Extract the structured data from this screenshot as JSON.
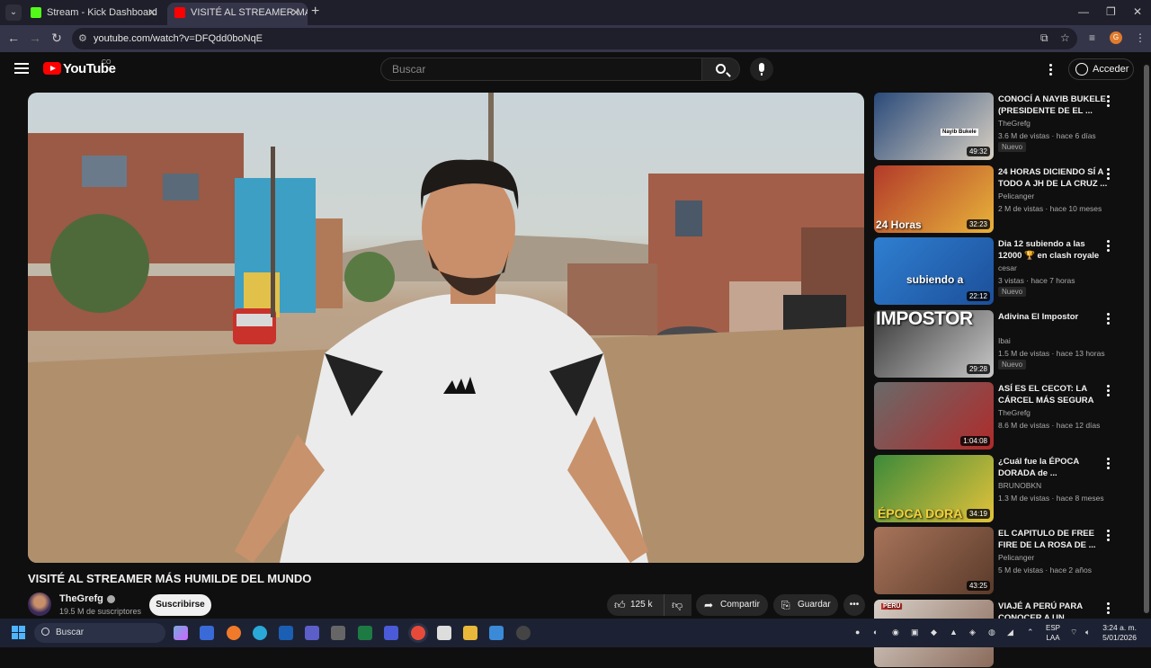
{
  "browser": {
    "tabs": [
      {
        "title": "Stream - Kick Dashboard",
        "favicon_color": "#53fc18",
        "active": false
      },
      {
        "title": "VISITÉ AL STREAMER MÁS H",
        "favicon_color": "#ff0000",
        "active": true
      }
    ],
    "url": "youtube.com/watch?v=DFQdd0boNqE",
    "profile_initial": "G"
  },
  "youtube": {
    "logo_text": "YouTube",
    "region": "CO",
    "search_placeholder": "Buscar",
    "signin_label": "Acceder"
  },
  "video": {
    "title": "VISITÉ AL STREAMER MÁS HUMILDE DEL MUNDO",
    "channel": "TheGrefg",
    "subscribers": "19.5 M de suscriptores",
    "subscribe_label": "Suscribirse",
    "likes": "125 k",
    "share_label": "Compartir",
    "save_label": "Guardar"
  },
  "recommendations": [
    {
      "title": "CONOCÍ A NAYIB BUKELE (PRESIDENTE DE EL ...",
      "channel": "TheGrefg",
      "meta": "3.6 M de vistas · hace 6 días",
      "badge": "Nuevo",
      "duration": "49:32",
      "overlay": "Nayib Bukele",
      "colors": [
        "#2a4a7a",
        "#d8d0c2"
      ]
    },
    {
      "title": "24 HORAS DICIENDO SÍ A TODO A JH DE LA CRUZ ...",
      "channel": "Pelicanger",
      "meta": "2 M de vistas · hace 10 meses",
      "badge": "",
      "duration": "32:23",
      "overlay": "24 Horas",
      "colors": [
        "#b23a2a",
        "#e8b33a"
      ]
    },
    {
      "title": "Dia 12 subiendo a las 12000 🏆 en clash royale",
      "channel": "cesar",
      "meta": "3 vistas · hace 7 horas",
      "badge": "Nuevo",
      "duration": "22:12",
      "overlay": "subiendo a",
      "colors": [
        "#2f7fd1",
        "#1c4f9a"
      ]
    },
    {
      "title": "Adivina El Impostor",
      "channel": "Ibai",
      "meta": "1.5 M de vistas · hace 13 horas",
      "badge": "Nuevo",
      "duration": "29:28",
      "overlay": "IMPOSTOR",
      "colors": [
        "#3a3a3a",
        "#c8c8c8"
      ]
    },
    {
      "title": "ASÍ ES EL CECOT: LA CÁRCEL MÁS SEGURA D...",
      "channel": "TheGrefg",
      "meta": "8.6 M de vistas · hace 12 días",
      "badge": "",
      "duration": "1:04:08",
      "overlay": "",
      "colors": [
        "#6a6a6a",
        "#b02a2a"
      ]
    },
    {
      "title": "¿Cuál fue la ÉPOCA DORADA de ...",
      "channel": "BRUNOBKN",
      "meta": "1.3 M de vistas · hace 8 meses",
      "badge": "",
      "duration": "34:19",
      "overlay": "ÉPOCA DORA",
      "colors": [
        "#3c8a3a",
        "#e3c23a"
      ]
    },
    {
      "title": "EL CAPITULO DE FREE FIRE DE LA ROSA DE ...",
      "channel": "Pelicanger",
      "meta": "5 M de vistas · hace 2 años",
      "badge": "",
      "duration": "43:25",
      "overlay": "",
      "colors": [
        "#a8745a",
        "#5a3a2a"
      ]
    },
    {
      "title": "VIAJÉ A PERÚ PARA CONOCER A UN ...",
      "channel": "",
      "meta": "",
      "badge": "",
      "duration": "",
      "overlay": "PERÚ",
      "colors": [
        "#d8d0c8",
        "#8a6a5a"
      ]
    }
  ],
  "taskbar": {
    "search_label": "Buscar",
    "lang_line1": "ESP",
    "lang_line2": "LAA",
    "time": "3:24 a. m.",
    "date": "5/01/2026"
  }
}
